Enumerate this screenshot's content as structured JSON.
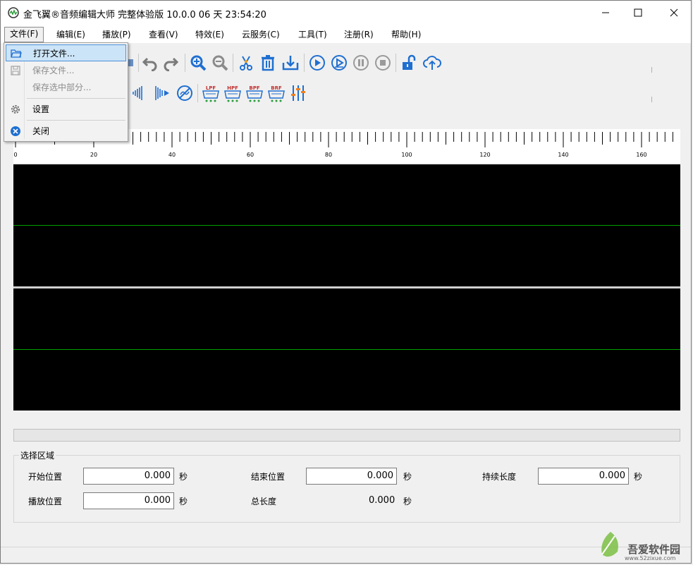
{
  "window": {
    "title": "金飞翼®音频编辑大师 完整体验版 10.0.0 06 天 23:54:20",
    "accent_color": "#2a7fd4",
    "icon": "app-logo-icon"
  },
  "menu": [
    {
      "label": "文件(F)"
    },
    {
      "label": "编辑(E)"
    },
    {
      "label": "播放(P)"
    },
    {
      "label": "查看(V)"
    },
    {
      "label": "特效(E)"
    },
    {
      "label": "云服务(C)"
    },
    {
      "label": "工具(T)"
    },
    {
      "label": "注册(R)"
    },
    {
      "label": "帮助(H)"
    }
  ],
  "file_menu": {
    "items": [
      {
        "label": "打开文件...",
        "icon": "folder-open-icon",
        "state": "highlighted"
      },
      {
        "label": "保存文件...",
        "icon": "save-icon",
        "state": "disabled"
      },
      {
        "label": "保存选中部分...",
        "icon": "",
        "state": "disabled"
      },
      {
        "label": "设置",
        "icon": "gear-icon",
        "state": "enabled"
      },
      {
        "label": "关闭",
        "icon": "close-circle-icon",
        "state": "enabled"
      }
    ]
  },
  "filter_labels": [
    "LPF",
    "HPF",
    "BPF",
    "BRF"
  ],
  "ruler": {
    "ticks": [
      "0",
      "20",
      "40",
      "60",
      "80",
      "100",
      "120",
      "140",
      "160"
    ]
  },
  "waveform": {
    "background": "#000000",
    "centerline_color": "#00a000",
    "channels": 2
  },
  "selection": {
    "group_title": "选择区域",
    "start_label": "开始位置",
    "start_value": "0.000",
    "end_label": "结束位置",
    "end_value": "0.000",
    "duration_label": "持续长度",
    "duration_value": "0.000",
    "play_label": "播放位置",
    "play_value": "0.000",
    "total_label": "总长度",
    "total_value": "0.000",
    "unit": "秒"
  },
  "watermark": {
    "name": "吾爱软件园",
    "url": "www.52zixue.com"
  }
}
